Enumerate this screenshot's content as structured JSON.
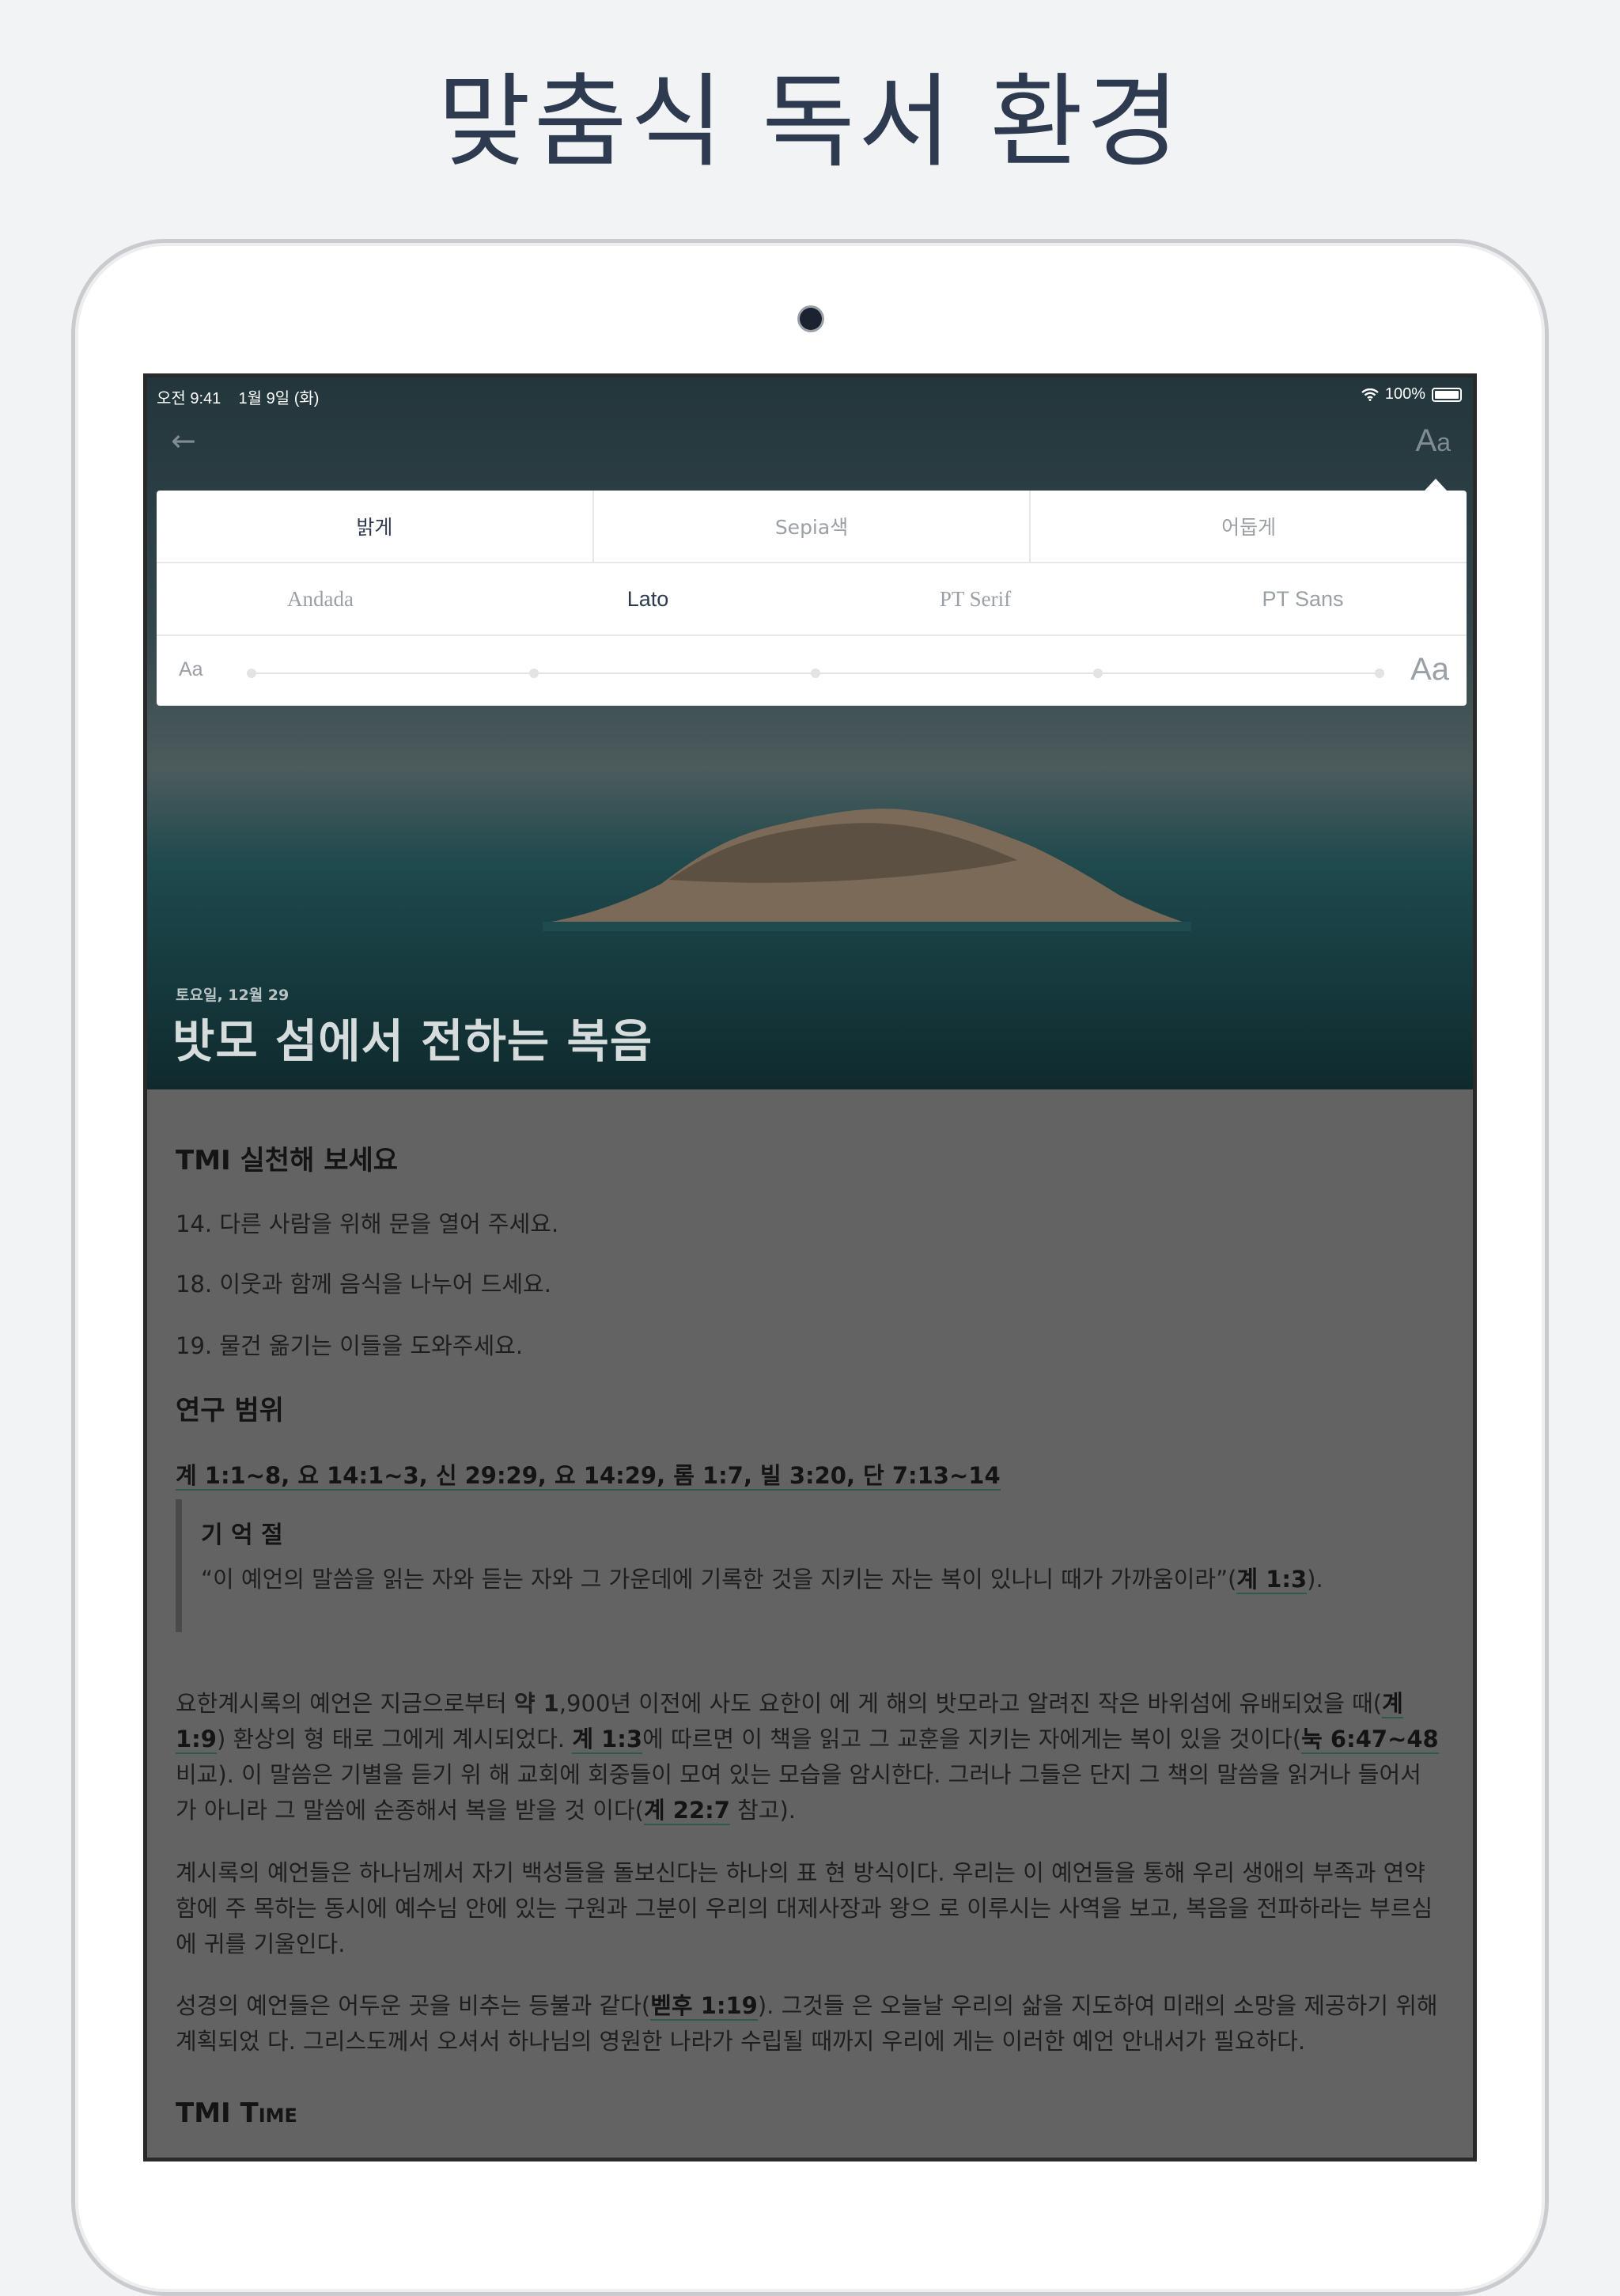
{
  "promo": {
    "title": "맞춤식 독서 환경"
  },
  "status_bar": {
    "time": "오전 9:41",
    "date": "1월 9일 (화)",
    "battery": "100%"
  },
  "nav": {
    "back_icon": "arrow-left-icon",
    "font_settings_label": "A",
    "font_settings_label_small": "a"
  },
  "settings_panel": {
    "themes": [
      {
        "label": "밝게",
        "active": true
      },
      {
        "label": "Sepia색",
        "active": false
      },
      {
        "label": "어둡게",
        "active": false
      }
    ],
    "fonts": [
      {
        "label": "Andada",
        "active": false
      },
      {
        "label": "Lato",
        "active": true
      },
      {
        "label": "PT Serif",
        "active": false
      },
      {
        "label": "PT Sans",
        "active": false
      }
    ],
    "size_small_label": "Aa",
    "size_large_label": "Aa",
    "size_steps": 5,
    "size_selected_index": 0
  },
  "hero": {
    "date": "토요일, 12월 29",
    "title": "밧모 섬에서 전하는 복음"
  },
  "article": {
    "tmi_heading": "TMI 실천해 보세요",
    "tmi_items": [
      "14. 다른 사람을 위해 문을 열어 주세요.",
      "18. 이웃과 함께 음식을 나누어 드세요.",
      "19. 물건 옮기는 이들을 도와주세요."
    ],
    "study_heading": "연구 범위",
    "study_range": "계 1:1~8, 요 14:1~3, 신 29:29, 요 14:29, 롬 1:7, 빌 3:20, 단 7:13~14",
    "memory_heading": "기 억 절",
    "memory_text_a": "“이 예언의 말씀을 읽는 자와 듣는 자와 그 가운데에 기록한 것을 지키는 자는 복이 있나니 때가 가까움이라”(",
    "memory_ref": "계 1:3",
    "memory_text_b": ").",
    "p1": {
      "a": "요한계시록의 예언은 지금으로부터 ",
      "b": "약 1",
      "c": ",900년 이전에 사도 요한이 에 게 해의 밧모라고 알려진 작은 바위섬에 유배되었을 때(",
      "ref1": "계 1:9",
      "d": ") 환상의 형 태로 그에게 계시되었다. ",
      "ref2": "계 1:3",
      "e": "에 따르면 이 책을 읽고 그 교훈을 지키는 자에게는 복이 있을 것이다(",
      "ref3": "눅 6:47~48",
      "f": " 비교). 이 말씀은 기별을 듣기 위 해 교회에 회중들이 모여 있는 모습을 암시한다. 그러나 그들은 단지 그 책의 말씀을 읽거나 들어서가 아니라 그 말씀에 순종해서 복을 받을 것 이다(",
      "ref4": "계 22:7",
      "g": " 참고)."
    },
    "p2": "계시록의 예언들은 하나님께서 자기 백성들을 돌보신다는 하나의 표 현 방식이다. 우리는 이 예언들을 통해 우리 생애의 부족과 연약함에 주 목하는 동시에 예수님 안에 있는 구원과 그분이 우리의 대제사장과 왕으 로 이루시는 사역을 보고, 복음을 전파하라는 부르심에 귀를 기울인다.",
    "p3": {
      "a": "성경의 예언들은 어두운 곳을 비추는 등불과 같다(",
      "ref": "벧후 1:19",
      "b": "). 그것들 은 오늘날 우리의 삶을 지도하여 미래의 소망을 제공하기 위해 계획되었 다. 그리스도께서 오셔서 하나님의 영원한 나라가 수립될 때까지 우리에 게는 이러한 예언 안내서가 필요하다."
    },
    "tmi_time_heading_a": "TMI T",
    "tmi_time_heading_b": "IME"
  }
}
